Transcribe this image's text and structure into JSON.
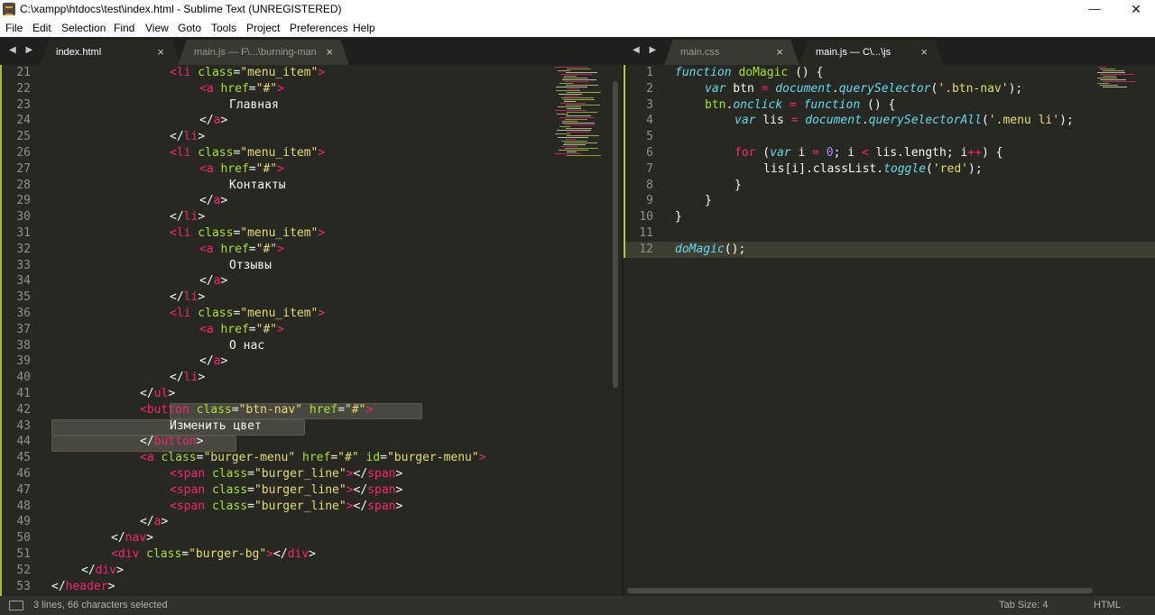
{
  "window": {
    "title": "C:\\xampp\\htdocs\\test\\index.html - Sublime Text (UNREGISTERED)",
    "minimize": "—",
    "restore": "❐",
    "close": "✕"
  },
  "menu": [
    "File",
    "Edit",
    "Selection",
    "Find",
    "View",
    "Goto",
    "Tools",
    "Project",
    "Preferences",
    "Help"
  ],
  "left_tabs": [
    {
      "label": "index.html",
      "active": true
    },
    {
      "label": "main.js — F\\...\\burning-man",
      "active": false
    }
  ],
  "right_tabs": [
    {
      "label": "main.css",
      "active": false
    },
    {
      "label": "main.js — C\\...\\js",
      "active": true
    }
  ],
  "tab_close": "×",
  "tab_nav": "◀ ▶",
  "left_pane": {
    "line_numbers": [
      "21",
      "22",
      "23",
      "24",
      "25",
      "26",
      "27",
      "28",
      "29",
      "30",
      "31",
      "32",
      "33",
      "34",
      "35",
      "36",
      "37",
      "38",
      "39",
      "40",
      "41",
      "42",
      "43",
      "44",
      "45",
      "46",
      "47",
      "48",
      "49",
      "50",
      "51",
      "52",
      "53"
    ],
    "lines": [
      [
        {
          "c": "tg",
          "t": "<li"
        },
        {
          "c": "at",
          "t": " class"
        },
        {
          "c": "pl",
          "t": "="
        },
        {
          "c": "st",
          "t": "\"menu_item\""
        },
        {
          "c": "tg",
          "t": ">"
        }
      ],
      [
        {
          "c": "tg",
          "t": "<a"
        },
        {
          "c": "at",
          "t": " href"
        },
        {
          "c": "pl",
          "t": "="
        },
        {
          "c": "st",
          "t": "\"#\""
        },
        {
          "c": "tg",
          "t": ">"
        }
      ],
      [
        {
          "c": "pl",
          "t": "Главная"
        }
      ],
      [
        {
          "c": "pl",
          "t": "</"
        },
        {
          "c": "tg",
          "t": "a"
        },
        {
          "c": "pl",
          "t": ">"
        }
      ],
      [
        {
          "c": "pl",
          "t": "</"
        },
        {
          "c": "tg",
          "t": "li"
        },
        {
          "c": "pl",
          "t": ">"
        }
      ],
      [
        {
          "c": "tg",
          "t": "<li"
        },
        {
          "c": "at",
          "t": " class"
        },
        {
          "c": "pl",
          "t": "="
        },
        {
          "c": "st",
          "t": "\"menu_item\""
        },
        {
          "c": "tg",
          "t": ">"
        }
      ],
      [
        {
          "c": "tg",
          "t": "<a"
        },
        {
          "c": "at",
          "t": " href"
        },
        {
          "c": "pl",
          "t": "="
        },
        {
          "c": "st",
          "t": "\"#\""
        },
        {
          "c": "tg",
          "t": ">"
        }
      ],
      [
        {
          "c": "pl",
          "t": "Контакты"
        }
      ],
      [
        {
          "c": "pl",
          "t": "</"
        },
        {
          "c": "tg",
          "t": "a"
        },
        {
          "c": "pl",
          "t": ">"
        }
      ],
      [
        {
          "c": "pl",
          "t": "</"
        },
        {
          "c": "tg",
          "t": "li"
        },
        {
          "c": "pl",
          "t": ">"
        }
      ],
      [
        {
          "c": "tg",
          "t": "<li"
        },
        {
          "c": "at",
          "t": " class"
        },
        {
          "c": "pl",
          "t": "="
        },
        {
          "c": "st",
          "t": "\"menu_item\""
        },
        {
          "c": "tg",
          "t": ">"
        }
      ],
      [
        {
          "c": "tg",
          "t": "<a"
        },
        {
          "c": "at",
          "t": " href"
        },
        {
          "c": "pl",
          "t": "="
        },
        {
          "c": "st",
          "t": "\"#\""
        },
        {
          "c": "tg",
          "t": ">"
        }
      ],
      [
        {
          "c": "pl",
          "t": "Отзывы"
        }
      ],
      [
        {
          "c": "pl",
          "t": "</"
        },
        {
          "c": "tg",
          "t": "a"
        },
        {
          "c": "pl",
          "t": ">"
        }
      ],
      [
        {
          "c": "pl",
          "t": "</"
        },
        {
          "c": "tg",
          "t": "li"
        },
        {
          "c": "pl",
          "t": ">"
        }
      ],
      [
        {
          "c": "tg",
          "t": "<li"
        },
        {
          "c": "at",
          "t": " class"
        },
        {
          "c": "pl",
          "t": "="
        },
        {
          "c": "st",
          "t": "\"menu_item\""
        },
        {
          "c": "tg",
          "t": ">"
        }
      ],
      [
        {
          "c": "tg",
          "t": "<a"
        },
        {
          "c": "at",
          "t": " href"
        },
        {
          "c": "pl",
          "t": "="
        },
        {
          "c": "st",
          "t": "\"#\""
        },
        {
          "c": "tg",
          "t": ">"
        }
      ],
      [
        {
          "c": "pl",
          "t": "О нас"
        }
      ],
      [
        {
          "c": "pl",
          "t": "</"
        },
        {
          "c": "tg",
          "t": "a"
        },
        {
          "c": "pl",
          "t": ">"
        }
      ],
      [
        {
          "c": "pl",
          "t": "</"
        },
        {
          "c": "tg",
          "t": "li"
        },
        {
          "c": "pl",
          "t": ">"
        }
      ],
      [
        {
          "c": "pl",
          "t": "</"
        },
        {
          "c": "tg",
          "t": "ul"
        },
        {
          "c": "pl",
          "t": ">"
        }
      ],
      [
        {
          "c": "tg",
          "t": "<button"
        },
        {
          "c": "at",
          "t": " class"
        },
        {
          "c": "pl",
          "t": "="
        },
        {
          "c": "st",
          "t": "\"btn-nav\""
        },
        {
          "c": "at",
          "t": " href"
        },
        {
          "c": "pl",
          "t": "="
        },
        {
          "c": "st",
          "t": "\"#\""
        },
        {
          "c": "tg",
          "t": ">"
        }
      ],
      [
        {
          "c": "pl",
          "t": "Изменить цвет"
        }
      ],
      [
        {
          "c": "pl",
          "t": "</"
        },
        {
          "c": "tg",
          "t": "button"
        },
        {
          "c": "pl",
          "t": ">"
        }
      ],
      [
        {
          "c": "tg",
          "t": "<a"
        },
        {
          "c": "at",
          "t": " class"
        },
        {
          "c": "pl",
          "t": "="
        },
        {
          "c": "st",
          "t": "\"burger-menu\""
        },
        {
          "c": "at",
          "t": " href"
        },
        {
          "c": "pl",
          "t": "="
        },
        {
          "c": "st",
          "t": "\"#\""
        },
        {
          "c": "at",
          "t": " id"
        },
        {
          "c": "pl",
          "t": "="
        },
        {
          "c": "st",
          "t": "\"burger-menu\""
        },
        {
          "c": "tg",
          "t": ">"
        }
      ],
      [
        {
          "c": "tg",
          "t": "<span"
        },
        {
          "c": "at",
          "t": " class"
        },
        {
          "c": "pl",
          "t": "="
        },
        {
          "c": "st",
          "t": "\"burger_line\""
        },
        {
          "c": "tg",
          "t": ">"
        },
        {
          "c": "pl",
          "t": "</"
        },
        {
          "c": "tg",
          "t": "span"
        },
        {
          "c": "pl",
          "t": ">"
        }
      ],
      [
        {
          "c": "tg",
          "t": "<span"
        },
        {
          "c": "at",
          "t": " class"
        },
        {
          "c": "pl",
          "t": "="
        },
        {
          "c": "st",
          "t": "\"burger_line\""
        },
        {
          "c": "tg",
          "t": ">"
        },
        {
          "c": "pl",
          "t": "</"
        },
        {
          "c": "tg",
          "t": "span"
        },
        {
          "c": "pl",
          "t": ">"
        }
      ],
      [
        {
          "c": "tg",
          "t": "<span"
        },
        {
          "c": "at",
          "t": " class"
        },
        {
          "c": "pl",
          "t": "="
        },
        {
          "c": "st",
          "t": "\"burger_line\""
        },
        {
          "c": "tg",
          "t": ">"
        },
        {
          "c": "pl",
          "t": "</"
        },
        {
          "c": "tg",
          "t": "span"
        },
        {
          "c": "pl",
          "t": ">"
        }
      ],
      [
        {
          "c": "pl",
          "t": "</"
        },
        {
          "c": "tg",
          "t": "a"
        },
        {
          "c": "pl",
          "t": ">"
        }
      ],
      [
        {
          "c": "pl",
          "t": "</"
        },
        {
          "c": "tg",
          "t": "nav"
        },
        {
          "c": "pl",
          "t": ">"
        }
      ],
      [
        {
          "c": "tg",
          "t": "<div"
        },
        {
          "c": "at",
          "t": " class"
        },
        {
          "c": "pl",
          "t": "="
        },
        {
          "c": "st",
          "t": "\"burger-bg\""
        },
        {
          "c": "tg",
          "t": ">"
        },
        {
          "c": "pl",
          "t": "</"
        },
        {
          "c": "tg",
          "t": "div"
        },
        {
          "c": "pl",
          "t": ">"
        }
      ],
      [
        {
          "c": "pl",
          "t": "</"
        },
        {
          "c": "tg",
          "t": "div"
        },
        {
          "c": "pl",
          "t": ">"
        }
      ],
      [
        {
          "c": "pl",
          "t": "</"
        },
        {
          "c": "tg",
          "t": "header"
        },
        {
          "c": "pl",
          "t": ">"
        }
      ]
    ]
  },
  "right_pane": {
    "line_numbers": [
      "1",
      "2",
      "3",
      "4",
      "5",
      "6",
      "7",
      "8",
      "9",
      "10",
      "11",
      "12"
    ],
    "lines": [
      [
        {
          "c": "kw",
          "t": "function"
        },
        {
          "c": "pl",
          "t": " "
        },
        {
          "c": "fn",
          "t": "doMagic"
        },
        {
          "c": "pl",
          "t": " () {"
        }
      ],
      [
        {
          "c": "kw",
          "t": "var"
        },
        {
          "c": "pl",
          "t": " btn "
        },
        {
          "c": "op",
          "t": "="
        },
        {
          "c": "pl",
          "t": " "
        },
        {
          "c": "ital",
          "t": "document"
        },
        {
          "c": "pl",
          "t": "."
        },
        {
          "c": "ital",
          "t": "querySelector"
        },
        {
          "c": "pl",
          "t": "("
        },
        {
          "c": "st",
          "t": "'.btn-nav'"
        },
        {
          "c": "pl",
          "t": ");"
        }
      ],
      [
        {
          "c": "fn",
          "t": "btn"
        },
        {
          "c": "pl",
          "t": "."
        },
        {
          "c": "ital",
          "t": "onclick"
        },
        {
          "c": "pl",
          "t": " "
        },
        {
          "c": "op",
          "t": "="
        },
        {
          "c": "pl",
          "t": " "
        },
        {
          "c": "kw",
          "t": "function"
        },
        {
          "c": "pl",
          "t": " () {"
        }
      ],
      [
        {
          "c": "kw",
          "t": "var"
        },
        {
          "c": "pl",
          "t": " lis "
        },
        {
          "c": "op",
          "t": "="
        },
        {
          "c": "pl",
          "t": " "
        },
        {
          "c": "ital",
          "t": "document"
        },
        {
          "c": "pl",
          "t": "."
        },
        {
          "c": "ital",
          "t": "querySelectorAll"
        },
        {
          "c": "pl",
          "t": "("
        },
        {
          "c": "st",
          "t": "'.menu li'"
        },
        {
          "c": "pl",
          "t": ");"
        }
      ],
      [],
      [
        {
          "c": "op",
          "t": "for"
        },
        {
          "c": "pl",
          "t": " ("
        },
        {
          "c": "kw",
          "t": "var"
        },
        {
          "c": "pl",
          "t": " i "
        },
        {
          "c": "op",
          "t": "="
        },
        {
          "c": "pl",
          "t": " "
        },
        {
          "c": "nm",
          "t": "0"
        },
        {
          "c": "pl",
          "t": "; i "
        },
        {
          "c": "op",
          "t": "<"
        },
        {
          "c": "pl",
          "t": " lis.length; i"
        },
        {
          "c": "op",
          "t": "++"
        },
        {
          "c": "pl",
          "t": ") {"
        }
      ],
      [
        {
          "c": "pl",
          "t": "lis[i].classList."
        },
        {
          "c": "ital",
          "t": "toggle"
        },
        {
          "c": "pl",
          "t": "("
        },
        {
          "c": "st",
          "t": "'red'"
        },
        {
          "c": "pl",
          "t": ");"
        }
      ],
      [
        {
          "c": "pl",
          "t": "}"
        }
      ],
      [
        {
          "c": "pl",
          "t": "}"
        }
      ],
      [
        {
          "c": "pl",
          "t": "}"
        }
      ],
      [],
      [
        {
          "c": "ital",
          "t": "doMagic"
        },
        {
          "c": "pl",
          "t": "();"
        }
      ]
    ]
  },
  "status": {
    "selection": "3 lines, 66 characters selected",
    "tab_size": "Tab Size: 4",
    "syntax": "HTML"
  }
}
